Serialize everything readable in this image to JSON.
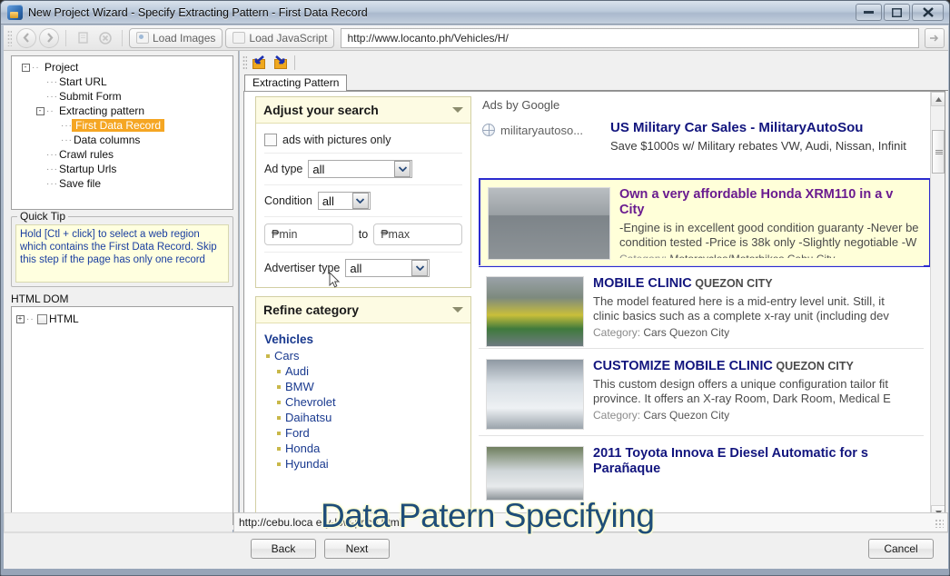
{
  "window": {
    "title": "New Project Wizard - Specify Extracting Pattern - First Data Record",
    "app_icon": "wizard-icon",
    "minimize": "–",
    "maximize": "□",
    "close": "✕"
  },
  "toolbar": {
    "back_icon": "back-arrow-icon",
    "forward_icon": "forward-arrow-icon",
    "refresh_icon": "refresh-icon",
    "stop_icon": "stop-icon",
    "load_images_label": "Load Images",
    "load_javascript_label": "Load JavaScript",
    "url_value": "http://www.locanto.ph/Vehicles/H/",
    "go_icon": "go-arrow-icon"
  },
  "sidebar": {
    "tree": [
      {
        "label": "Project",
        "level": 0,
        "expander": "-",
        "selected": false
      },
      {
        "label": "Start URL",
        "level": 1,
        "expander": "",
        "selected": false
      },
      {
        "label": "Submit Form",
        "level": 1,
        "expander": "",
        "selected": false
      },
      {
        "label": "Extracting pattern",
        "level": 1,
        "expander": "-",
        "selected": false
      },
      {
        "label": "First Data Record",
        "level": 2,
        "expander": "",
        "selected": true
      },
      {
        "label": "Data columns",
        "level": 2,
        "expander": "",
        "selected": false
      },
      {
        "label": "Crawl rules",
        "level": 1,
        "expander": "",
        "selected": false
      },
      {
        "label": "Startup Urls",
        "level": 1,
        "expander": "",
        "selected": false
      },
      {
        "label": "Save file",
        "level": 1,
        "expander": "",
        "selected": false
      }
    ],
    "quick_tip": {
      "legend": "Quick Tip",
      "text": "Hold [Ctl + click] to select a web region which contains the First Data Record. Skip this step if the page has only one record"
    },
    "html_dom": {
      "header": "HTML DOM",
      "root_label": "HTML",
      "root_expander": "+"
    }
  },
  "rightpanel": {
    "icon_left": "import-pattern-icon",
    "icon_right": "export-pattern-icon",
    "tab_label": "Extracting Pattern"
  },
  "page": {
    "adjust_search": {
      "header": "Adjust your search",
      "pictures_checkbox_label": "ads with pictures only",
      "ad_type_label": "Ad type",
      "ad_type_value": "all",
      "condition_label": "Condition",
      "condition_value": "all",
      "price_min_placeholder": "₱min",
      "price_to_label": "to",
      "price_max_placeholder": "₱max",
      "advertiser_label": "Advertiser type",
      "advertiser_value": "all"
    },
    "refine_category": {
      "header": "Refine category",
      "group_title": "Vehicles",
      "parent": "Cars",
      "children": [
        "Audi",
        "BMW",
        "Chevrolet",
        "Daihatsu",
        "Ford",
        "Honda",
        "Hyundai"
      ]
    },
    "ads_header": "Ads by Google",
    "google_ad": {
      "site": "militaryautoso...",
      "title": "US Military Car Sales - MilitaryAutoSou",
      "desc": "Save $1000s w/ Military rebates VW, Audi, Nissan, Infinit"
    },
    "records": [
      {
        "title": "Own a very affordable Honda XRM110 in a v",
        "title2": "City",
        "desc1": "-Engine is in excellent good condition guaranty -Never be",
        "desc2": "condition tested -Price is 38k only -Slightly negotiable -W",
        "cat_label": "Category:",
        "cat_value": "Motorcycles/Motorbikes Cebu City",
        "selected": true,
        "thumb": "motorcycle-thumbnail"
      },
      {
        "title": "MOBILE CLINIC",
        "title_sub": "QUEZON CITY",
        "desc1": "The model featured here is a mid-entry level unit. Still, it",
        "desc2": "clinic basics such as a complete x-ray unit (including dev",
        "cat_label": "Category:",
        "cat_value": "Cars Quezon City",
        "selected": false,
        "thumb": "green-yellow-truck-thumbnail"
      },
      {
        "title": "CUSTOMIZE MOBILE CLINIC",
        "title_sub": "QUEZON CITY",
        "desc1": "This custom design offers a unique configuration tailor fit",
        "desc2": "province. It offers an X-ray Room, Dark Room, Medical E",
        "cat_label": "Category:",
        "cat_value": "Cars Quezon City",
        "selected": false,
        "thumb": "white-mobile-clinic-thumbnail"
      },
      {
        "title": "2011 Toyota Innova E Diesel Automatic for s",
        "title2": "Parañaque",
        "desc1": "",
        "desc2": "",
        "cat_label": "",
        "cat_value": "",
        "selected": false,
        "thumb": "white-van-thumbnail"
      }
    ]
  },
  "status": {
    "url": "http://cebu.loca                                                       ery-low-price.html"
  },
  "footer": {
    "back_label": "Back",
    "next_label": "Next",
    "cancel_label": "Cancel"
  },
  "overlay": {
    "caption": "Data Patern Specifying"
  },
  "colors": {
    "selection_highlight": "#f5a623",
    "record_border": "#2b2bcf",
    "record_bg": "#ffffd9",
    "tip_text": "#1b3fa0",
    "link_blue": "#1a3a8f"
  }
}
